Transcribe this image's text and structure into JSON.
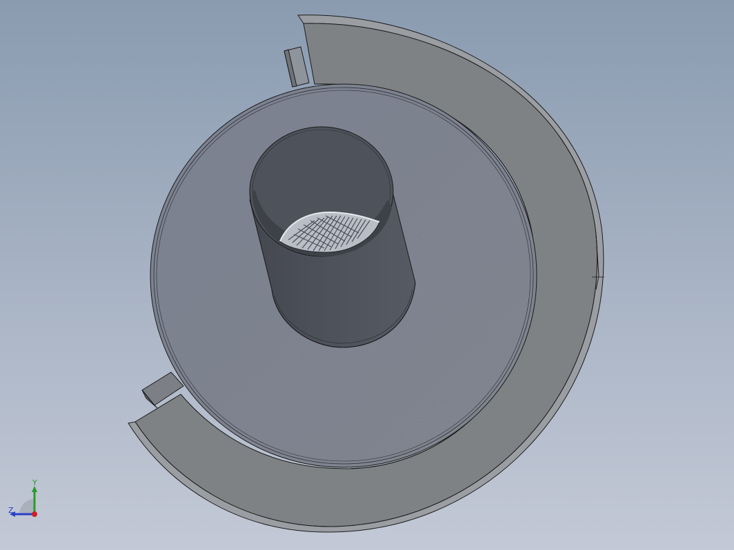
{
  "viewport": {
    "background_top": "#8a9bb0",
    "background_bottom": "#c3c9d6"
  },
  "model": {
    "outer_shell_color": "#7f8284",
    "plate_color": "#7d8290",
    "inner_tube_color": "#4a4e56",
    "spiral_strut_color": "#d9dde3",
    "edge_color": "#1a1a1a"
  },
  "triad": {
    "x_label": "",
    "y_label": "Y",
    "z_label": "Z",
    "y_color": "#2a9a2a",
    "z_color": "#2a3fc8",
    "x_color": "#d02020"
  }
}
